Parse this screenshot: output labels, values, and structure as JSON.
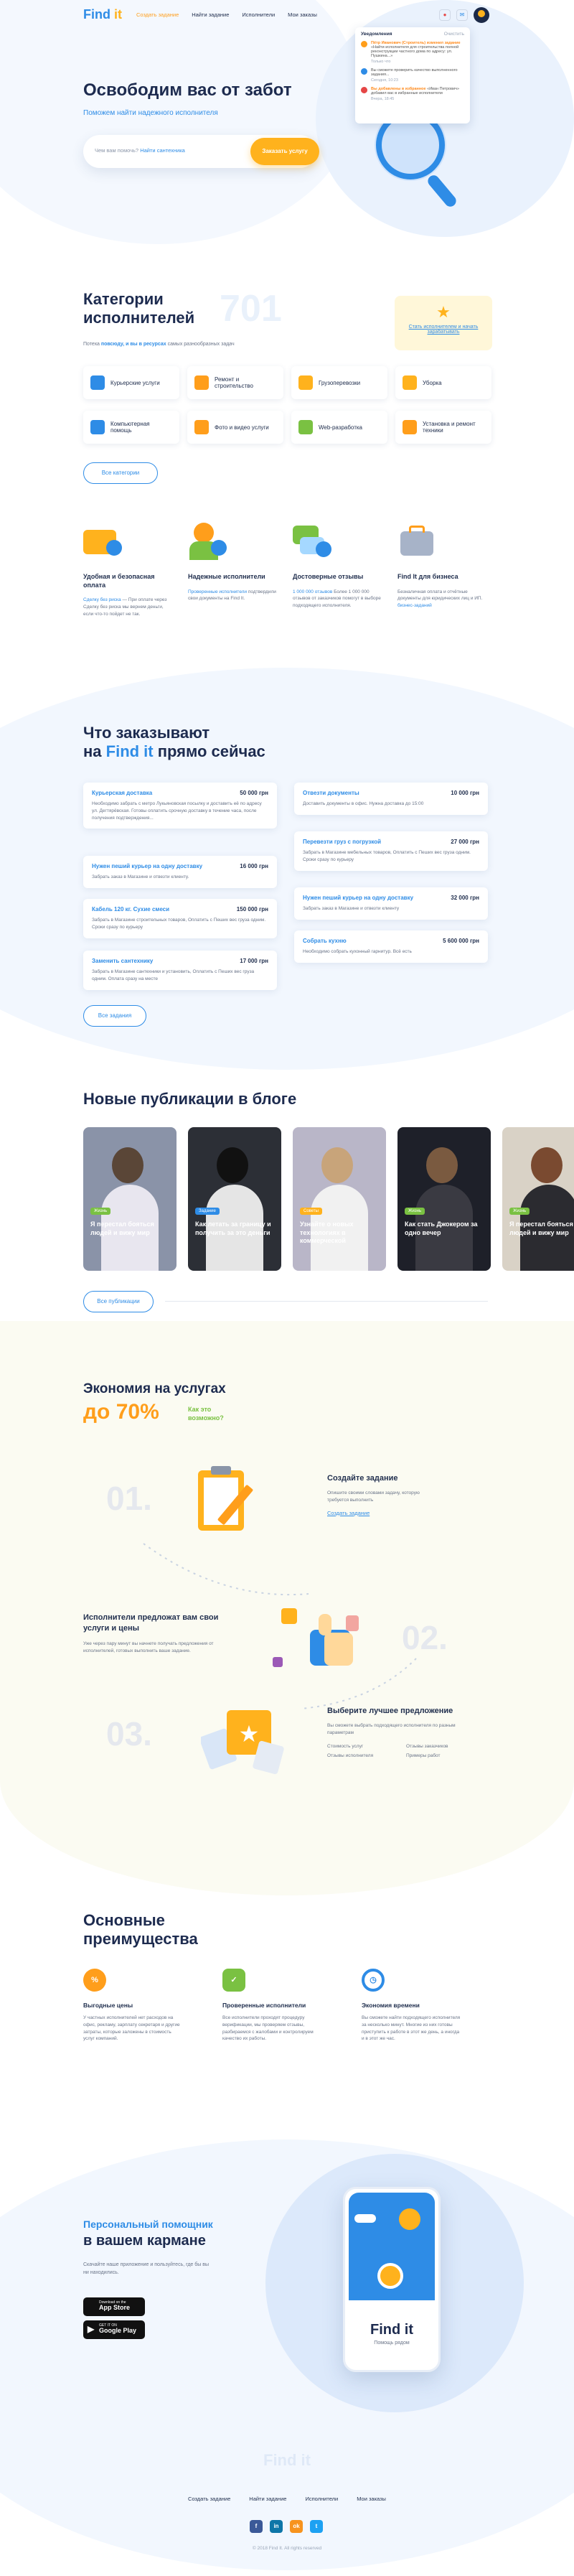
{
  "header": {
    "logo": "Find",
    "logo_accent": "it",
    "nav": [
      "Создать задание",
      "Найти задание",
      "Исполнители",
      "Мои заказы"
    ]
  },
  "notifications": {
    "title": "Уведомления",
    "clear": "Очистить",
    "items": [
      {
        "text_highlight": "Пётр Иванович (Строитель) изменил задание",
        "text": "«Найти исполнителя для строительства полной реконструкции частного дома по адресу: ул. Пушкина...»",
        "time": "Только что"
      },
      {
        "text": "Вы сможете проверить качество выполненного задания...",
        "time": "Сегодня, 10:23"
      },
      {
        "text_highlight": "Вы добавлены в избранное",
        "text": "«Иван Петрович» добавил вас в избранные исполнители",
        "time": "Вчера, 18:45"
      }
    ]
  },
  "hero": {
    "title_line1": "Освободим вас от забот",
    "subtitle": "Поможем найти надежного исполнителя",
    "search_placeholder": "Чем вам помочь?",
    "search_link": "Найти сантехника",
    "search_button": "Заказать услугу"
  },
  "categories": {
    "title_line1": "Категории",
    "title_line2": "исполнителей",
    "count": "701",
    "subtitle_pre": "Потеха ",
    "subtitle_link": "повсюду, и вы в ресурсах",
    "subtitle_post": " самых разнообразных задач",
    "tip_link": "Стать исполнителем и начать зарабатывать",
    "items": [
      "Курьерские услуги",
      "Ремонт и строительство",
      "Грузоперевозки",
      "Уборка",
      "Компьютерная помощь",
      "Фото и видео услуги",
      "Web-разработка",
      "Установка и ремонт техники"
    ],
    "all_button": "Все категории",
    "colors": [
      "#2e8ce6",
      "#ff9e1b",
      "#ffb21d",
      "#ffb21d",
      "#2e8ce6",
      "#ff9e1b",
      "#7ac142",
      "#ff9e1b"
    ]
  },
  "features": [
    {
      "title": "Удобная и безопасная оплата",
      "text_link": "Сделку без риска",
      "text": "При оплате через Сделку без риска мы вернем деньги, если что-то пойдет не так."
    },
    {
      "title": "Надежные исполнители",
      "text_link": "Проверенные исполнители",
      "text": "подтвердили свои документы на Find It."
    },
    {
      "title": "Достоверные отзывы",
      "text_link": "1 000 000 отзывов",
      "text": "Более 1 000 000 отзывов от заказчиков помогут в выборе подходящего исполнителя."
    },
    {
      "title": "Find It для бизнеса",
      "text_link": "бизнес-заданий",
      "text": "Безналичная оплата и отчётные документы для юридических лиц и ИП."
    }
  ],
  "orders": {
    "title_line1": "Что заказывают",
    "title_pre": "на ",
    "title_brand": "Find it",
    "title_post": " прямо сейчас",
    "left": [
      {
        "title": "Курьерская доставка",
        "price": "50 000 грн",
        "text": "Необходимо забрать с метро Лукьяновская посылку и доставить её по адресу ул. Дегтярёвская. Готовы оплатить срочную доставку в течение часа, после получения подтверждения..."
      },
      {
        "title": "Нужен пеший курьер на одну доставку",
        "price": "16 000 грн",
        "text": "Забрать заказ в Магазине и отвезти клиенту."
      },
      {
        "title": "Кабель 120 кг. Сухие смеси",
        "price": "150 000 грн",
        "text": "Забрать в Магазине строительных товаров, Оплатить с Пеших вес груза одним. Сроки сразу по курьеру"
      },
      {
        "title": "Заменить сантехнику",
        "price": "17 000 грн",
        "text": "Забрать в Магазине сантехники и установить, Оплатить с Пеших вес груза одним. Оплата сразу на месте"
      }
    ],
    "right": [
      {
        "title": "Отвезти документы",
        "price": "10 000 грн",
        "text": "Доставить документы в офис. Нужна доставка до 15:00"
      },
      {
        "title": "Перевезти груз с погрузкой",
        "price": "27 000 грн",
        "text": "Забрать в Магазине мебельных товаров, Оплатить с Пеших вес груза одним. Сроки сразу по курьеру"
      },
      {
        "title": "Нужен пеший курьер на одну доставку",
        "price": "32 000 грн",
        "text": "Забрать заказ в Магазине и отвезти клиенту"
      },
      {
        "title": "Собрать кухню",
        "price": "5 600 000 грн",
        "text": "Необходимо собрать кухонный гарнитур. Всё есть"
      }
    ],
    "all_button": "Все задания"
  },
  "blog": {
    "title": "Новые публикации в блоге",
    "all_button": "Все публикации",
    "posts": [
      {
        "tag": "Жизнь",
        "title": "Я перестал бояться людей и вижу мир",
        "bg": "#8a93a8",
        "tag_color": "#7ac142"
      },
      {
        "tag": "Задание",
        "title": "Как летать за границу и получить за это деньги",
        "bg": "#2c2f36",
        "tag_color": "#2e8ce6"
      },
      {
        "tag": "Советы",
        "title": "Узнайте о новых технологиях в коммерческой",
        "bg": "#b9b6c8",
        "tag_color": "#ffb21d"
      },
      {
        "tag": "Жизнь",
        "title": "Как стать Джокером за одно вечер",
        "bg": "#1e2029",
        "tag_color": "#7ac142"
      },
      {
        "tag": "Жизнь",
        "title": "Я перестал бояться людей и вижу мир",
        "bg": "#d9d2c6",
        "tag_color": "#7ac142"
      }
    ]
  },
  "economy": {
    "title": "Экономия на услугах",
    "title_accent": "до 70%",
    "question": "Как это возможно?",
    "steps": [
      {
        "num": "01.",
        "title": "Создайте задание",
        "text": "Опишите своими словами задачу, которую требуется выполнить",
        "link": "Создать задание"
      },
      {
        "num": "02.",
        "title": "Исполнители предложат вам свои услуги и цены",
        "text": "Уже через пару минут вы начнете получать предложения от исполнителей, готовых выполнить ваше задание."
      },
      {
        "num": "03.",
        "title": "Выберите лучшее предложение",
        "text": "Вы сможете выбрать подходящего исполнителя по разным параметрам",
        "bullets": [
          "Стоимость услуг",
          "Отзывы заказчиков",
          "Отзывы исполнителя",
          "Примеры работ"
        ]
      }
    ]
  },
  "advantages": {
    "title_line1": "Основные",
    "title_line2": "преимущества",
    "items": [
      {
        "title": "Выгодные цены",
        "text": "У частных исполнителей нет расходов на офис, рекламу, зарплату секретаря и другие затраты, которые заложены в стоимость услуг компаний.",
        "color": "#ff9e1b"
      },
      {
        "title": "Проверенные исполнители",
        "text": "Все исполнители проходят процедуру верификации, мы проверяем отзывы, разбираемся с жалобами и контролируем качество их работы.",
        "color": "#7ac142"
      },
      {
        "title": "Экономия времени",
        "text": "Вы сможете найти подходящего исполнителя за несколько минут. Многие из них готовы приступить к работе в этот же день, а иногда и в этот же час.",
        "color": "#2e8ce6"
      }
    ]
  },
  "app": {
    "title_line1": "Персональный помощник",
    "title_line2": "в вашем кармане",
    "text": "Скачайте наше приложение и пользуйтесь, где бы вы ни находились.",
    "app_store_small": "Download on the",
    "app_store": "App Store",
    "google_small": "GET IT ON",
    "google": "Google Play",
    "phone_logo": "Find it",
    "phone_sub": "Помощь рядом"
  },
  "footer": {
    "logo": "Find it",
    "nav": [
      "Создать задание",
      "Найти задание",
      "Исполнители",
      "Мои заказы"
    ],
    "social": [
      "f",
      "in",
      "ok",
      "t"
    ],
    "copyright": "© 2018 Find It. All rights reserved"
  }
}
